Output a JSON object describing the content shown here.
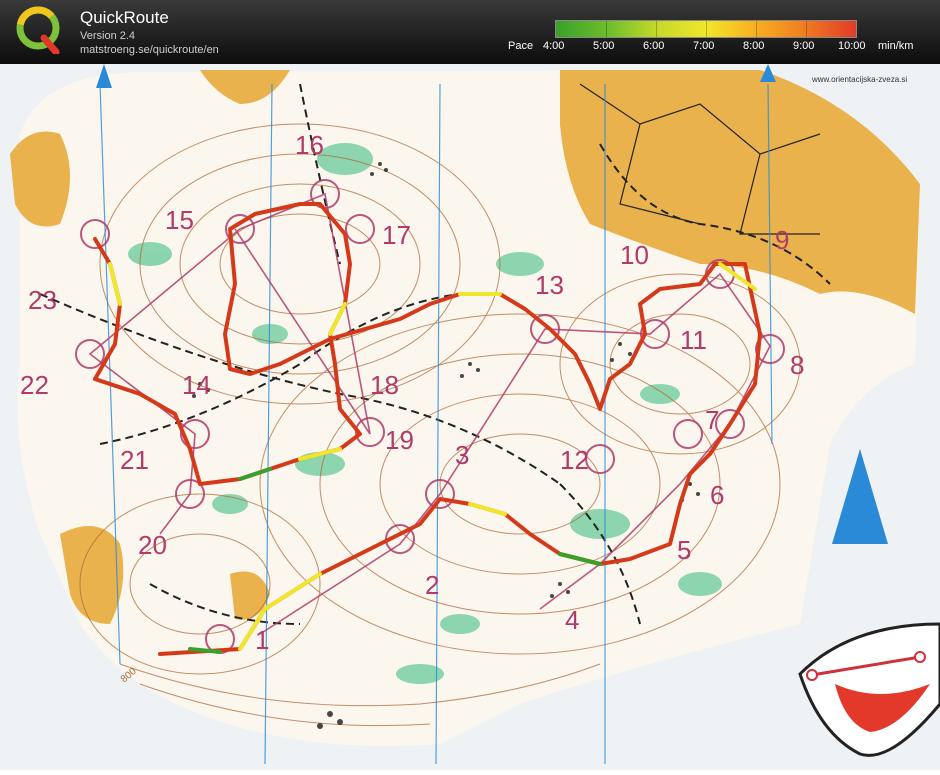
{
  "app": {
    "name": "QuickRoute",
    "version": "Version 2.4",
    "url": "matstroeng.se/quickroute/en"
  },
  "pace_legend": {
    "label": "Pace",
    "values": [
      "4:00",
      "5:00",
      "6:00",
      "7:00",
      "8:00",
      "9:00",
      "10:00"
    ],
    "unit": "min/km",
    "colors": [
      "#3aa02a",
      "#c7d92a",
      "#f0e72a",
      "#f8b020",
      "#e23a2a"
    ]
  },
  "map": {
    "credit": "www.orientacijska-zveza.si",
    "contour_label": "800",
    "controls": [
      "1",
      "2",
      "3",
      "4",
      "5",
      "6",
      "7",
      "8",
      "9",
      "10",
      "11",
      "12",
      "13",
      "14",
      "15",
      "16",
      "17",
      "18",
      "19",
      "20",
      "21",
      "22",
      "23"
    ],
    "colors": {
      "open_land": "#e9b24c",
      "vegetation": "#7fd0a6",
      "contours": "#b06a3a",
      "course": "#b03a6a",
      "north": "#2a8ad8",
      "route": "#d43a1a"
    }
  }
}
